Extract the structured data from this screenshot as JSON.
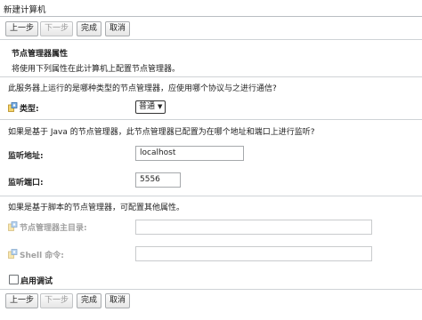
{
  "window": {
    "title": "新建计算机"
  },
  "toolbar_top": {
    "back_label": "上一步",
    "next_label": "下一步",
    "finish_label": "完成",
    "cancel_label": "取消"
  },
  "section": {
    "title": "节点管理器属性",
    "description": "将使用下列属性在此计算机上配置节点管理器。"
  },
  "type_question": "此服务器上运行的是哪种类型的节点管理器，应使用哪个协议与之进行通信?",
  "type_field": {
    "label": "类型:",
    "selected": "普通"
  },
  "java_question": "如果是基于 Java 的节点管理器，此节点管理器已配置为在哪个地址和端口上进行监听?",
  "listen_address": {
    "label": "监听地址:",
    "value": "localhost"
  },
  "listen_port": {
    "label": "监听端口:",
    "value": "5556"
  },
  "script_question": "如果是基于脚本的节点管理器，可配置其他属性。",
  "home_dir": {
    "label": "节点管理器主目录:",
    "value": ""
  },
  "shell_command": {
    "label": "Shell 命令:",
    "value": ""
  },
  "debug": {
    "label": "启用调试",
    "checked": false
  },
  "toolbar_bottom": {
    "back_label": "上一步",
    "next_label": "下一步",
    "finish_label": "完成",
    "cancel_label": "取消"
  },
  "icons": {
    "property_icon": "property-settings-icon",
    "chevron": "chevron-down-icon"
  }
}
